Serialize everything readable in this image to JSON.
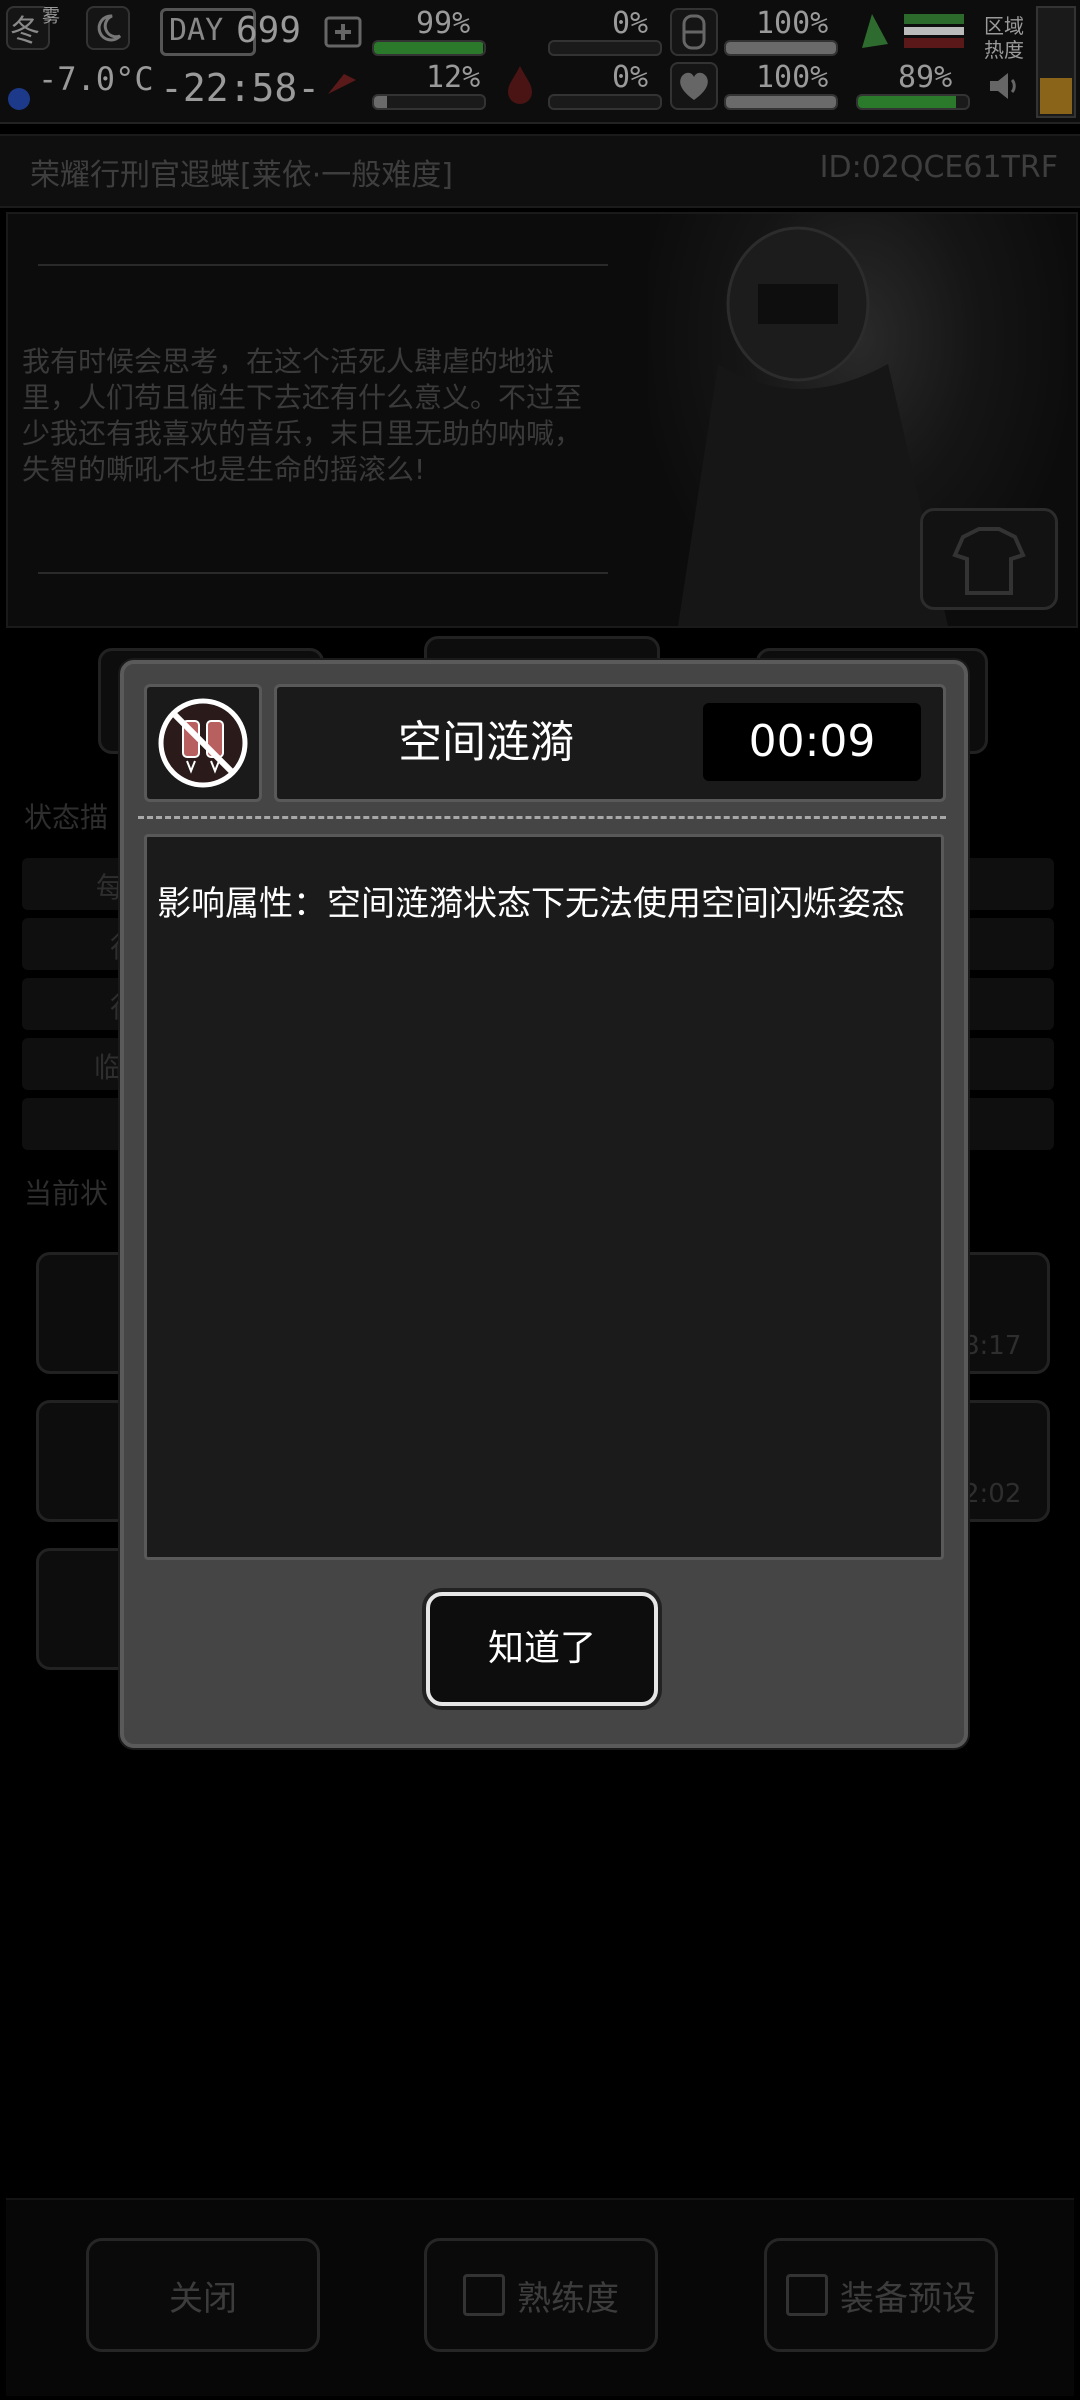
{
  "hud": {
    "season": "冬",
    "season_sub": "雾",
    "temperature": "-7.0°C",
    "day_label": "DAY",
    "day_number": "699",
    "clock": "-22:58-",
    "stats": [
      {
        "icon": "medkit-icon",
        "value": "99%",
        "fill": 0.99,
        "color": "#2b7a2b"
      },
      {
        "icon": "stomach-icon",
        "value": "0%",
        "fill": 0.0,
        "color": "#6a6a6a"
      },
      {
        "icon": "armor-icon",
        "value": "100%",
        "fill": 1.0,
        "color": "#6a6a6a"
      },
      {
        "icon": "food-icon",
        "value": "12%",
        "fill": 0.12,
        "color": "#6a6a6a"
      },
      {
        "icon": "blood-drop-icon",
        "value": "0%",
        "fill": 0.0,
        "color": "#6a6a6a"
      },
      {
        "icon": "heart-icon",
        "value": "100%",
        "fill": 1.0,
        "color": "#6a6a6a"
      }
    ],
    "stamina": {
      "value": "89%",
      "fill": 0.89
    },
    "zone_heat_label": "区域热度"
  },
  "page": {
    "title": "荣耀行刑官遐蝶[莱依·一般难度]",
    "id_text": "ID:02QCE61TRF",
    "story": "我有时候会思考，在这个活死人肆虐的地狱里，人们苟且偷生下去还有什么意义。不过至少我还有我喜欢的音乐，末日里无助的呐喊，失智的嘶吼不也是生命的摇滚么!",
    "section_status_desc": "状态描",
    "row_labels": [
      "每",
      "行",
      "行",
      "临",
      ""
    ],
    "section_current_status": "当前状",
    "tile_timers": [
      "8:17",
      "2:02"
    ],
    "bottom_buttons": {
      "close": "关闭",
      "proficiency": "熟练度",
      "equip_preset": "装备预设"
    }
  },
  "dialog": {
    "title": "空间涟漪",
    "timer": "00:09",
    "icon": "no-jetpack-icon",
    "body": "影响属性：空间涟漪状态下无法使用空间闪烁姿态",
    "confirm": "知道了"
  }
}
